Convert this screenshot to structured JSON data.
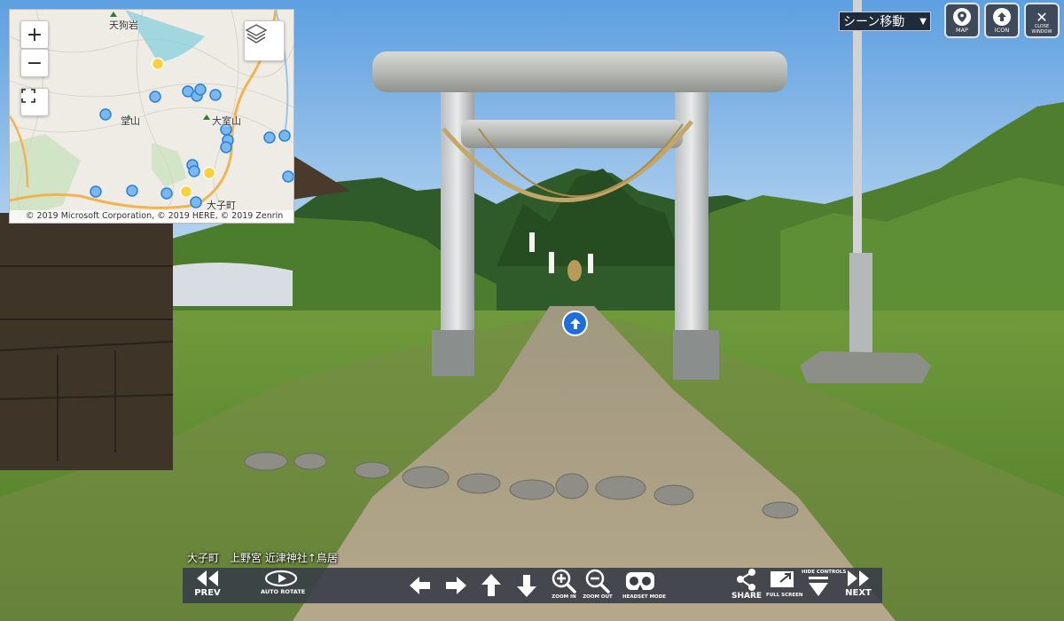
{
  "map": {
    "zoom_in_label": "+",
    "zoom_out_label": "−",
    "places": [
      "天狗岩",
      "堂山",
      "大室山",
      "大子町"
    ],
    "copyright": "© 2019 Microsoft Corporation, © 2019 HERE, © 2019 Zenrin"
  },
  "top": {
    "scene_select_value": "シーン移動",
    "map_label": "MAP",
    "icon_label": "ICON",
    "close_label": "CLOSE WINDOW"
  },
  "scene": {
    "title": "大子町　上野宮 近津神社↑鳥居"
  },
  "toolbar": {
    "prev": "PREV",
    "auto_rotate": "AUTO ROTATE",
    "zoom_in": "ZOOM IN",
    "zoom_out": "ZOOM OUT",
    "headset": "HEADSET MODE",
    "share": "SHARE",
    "full_screen": "FULL SCREEN",
    "hide_controls": "HIDE CONTROLS",
    "next": "NEXT"
  }
}
